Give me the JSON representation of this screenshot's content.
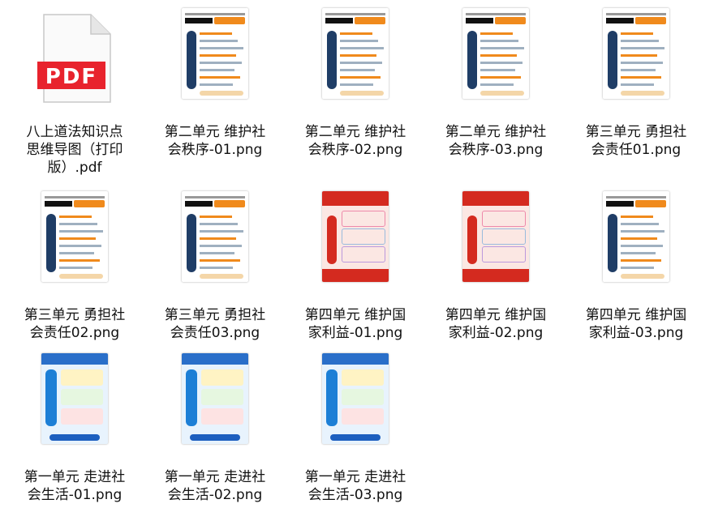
{
  "files": [
    {
      "name": "八上道法知识点思维导图（打印版）.pdf",
      "type": "pdf",
      "icon": "pdf-file-icon",
      "badge": "PDF"
    },
    {
      "name": "第二单元 维护社会秩序-01.png",
      "type": "png",
      "theme": "orange"
    },
    {
      "name": "第二单元 维护社会秩序-02.png",
      "type": "png",
      "theme": "orange"
    },
    {
      "name": "第二单元 维护社会秩序-03.png",
      "type": "png",
      "theme": "orange"
    },
    {
      "name": "第三单元 勇担社会责任01.png",
      "type": "png",
      "theme": "orange"
    },
    {
      "name": "第三单元 勇担社会责任02.png",
      "type": "png",
      "theme": "orange"
    },
    {
      "name": "第三单元 勇担社会责任03.png",
      "type": "png",
      "theme": "orange"
    },
    {
      "name": "第四单元 维护国家利益-01.png",
      "type": "png",
      "theme": "red"
    },
    {
      "name": "第四单元 维护国家利益-02.png",
      "type": "png",
      "theme": "red"
    },
    {
      "name": "第四单元 维护国家利益-03.png",
      "type": "png",
      "theme": "orange"
    },
    {
      "name": "第一单元 走进社会生活-01.png",
      "type": "png",
      "theme": "blue"
    },
    {
      "name": "第一单元 走进社会生活-02.png",
      "type": "png",
      "theme": "blue"
    },
    {
      "name": "第一单元 走进社会生活-03.png",
      "type": "png",
      "theme": "blue"
    }
  ],
  "labels": [
    [
      "八上道法知识点",
      "思维导图（打印",
      "版）.pdf"
    ],
    [
      "第二单元 维护社",
      "会秩序-01.png"
    ],
    [
      "第二单元 维护社",
      "会秩序-02.png"
    ],
    [
      "第二单元 维护社",
      "会秩序-03.png"
    ],
    [
      "第三单元 勇担社",
      "会责任01.png"
    ],
    [
      "第三单元 勇担社",
      "会责任02.png"
    ],
    [
      "第三单元 勇担社",
      "会责任03.png"
    ],
    [
      "第四单元 维护国",
      "家利益-01.png"
    ],
    [
      "第四单元 维护国",
      "家利益-02.png"
    ],
    [
      "第四单元 维护国",
      "家利益-03.png"
    ],
    [
      "第一单元 走进社",
      "会生活-01.png"
    ],
    [
      "第一单元 走进社",
      "会生活-02.png"
    ],
    [
      "第一单元 走进社",
      "会生活-03.png"
    ]
  ],
  "colors": {
    "pdf_red": "#e8232d",
    "orange": "#f08a1c",
    "red": "#d42a1f",
    "blue": "#1d7fd6",
    "navy": "#1f3d66"
  }
}
